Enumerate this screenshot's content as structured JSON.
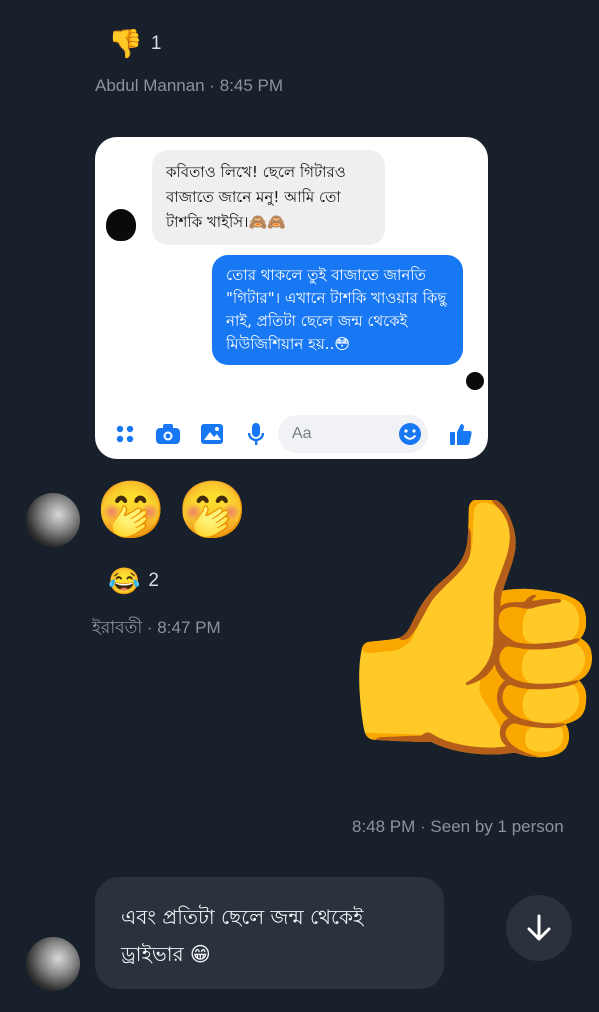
{
  "top_reaction": {
    "emoji_icon": "thumbs-down",
    "emoji": "👎",
    "count": "1"
  },
  "msg1_meta": "Abdul Mannan · 8:45 PM",
  "shared_screenshot": {
    "incoming_text": "কবিতাও লিখে! ছেলে গিটারও বাজাতে জানে মনু! আমি তো টাশকি খাইসি।🙈🙈",
    "outgoing_text": "তোর থাকলে তুই বাজাতে জানতি \"গিটার\"। এখানে টাশকি খাওয়ার কিছু নাই, প্রতিটা ছেলে জন্ম থেকেই মিউজিশিয়ান হয়..😳",
    "composer_placeholder": "Aa",
    "accent_color": "#1877f2"
  },
  "msg2": {
    "emojis": [
      "🤭",
      "🤭"
    ]
  },
  "msg2_reaction": {
    "emoji_icon": "laughing-with-tears",
    "emoji": "😂",
    "count": "2"
  },
  "msg2_meta": "ইরাবতী · 8:47 PM",
  "thumbs_sticker": "👍",
  "seen_meta": "8:48 PM · Seen by 1 person",
  "last_message": {
    "text": "এবং প্রতিটা ছেলে জন্ম থেকেই ড্রাইভার 😁"
  }
}
